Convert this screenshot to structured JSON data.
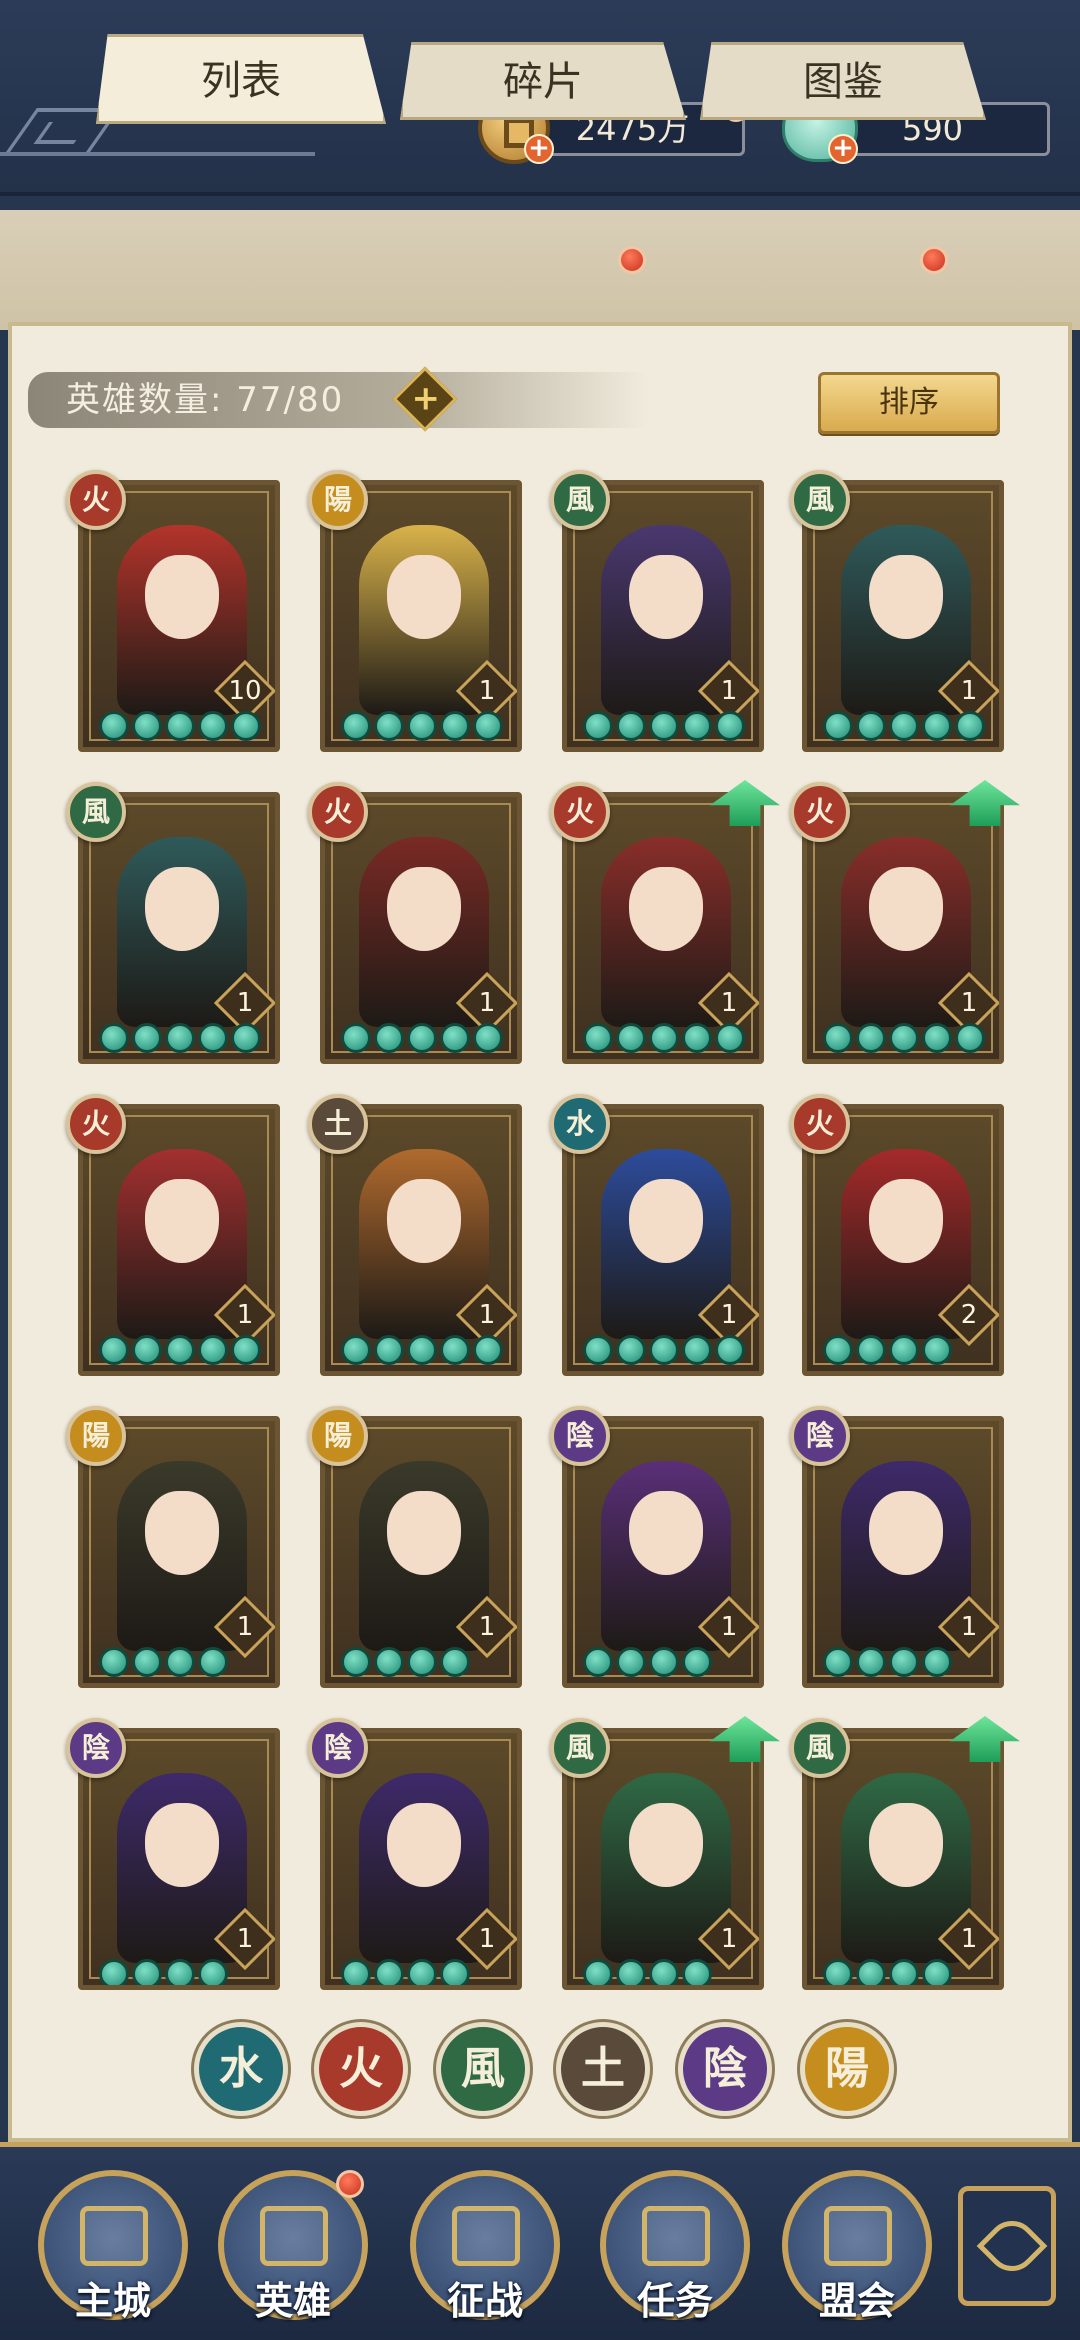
{
  "resources": {
    "coins": "2475万",
    "jade": "590"
  },
  "tabs": [
    {
      "label": "列表",
      "active": true,
      "has_dot": false
    },
    {
      "label": "碎片",
      "active": false,
      "has_dot": true
    },
    {
      "label": "图鉴",
      "active": false,
      "has_dot": true
    }
  ],
  "hero_count_label": "英雄数量: 77/80",
  "sort_label": "排序",
  "element_colors": {
    "fire": "#a83a2b",
    "yang": "#c58d1e",
    "wind": "#2f6a45",
    "yin": "#5c3a86",
    "water": "#1f6a73",
    "earth": "#5a4a3a"
  },
  "heroes": [
    {
      "element": "fire",
      "glyph": "火",
      "level": "10",
      "stars": 5,
      "upgradable": false,
      "tone": "#b3342b"
    },
    {
      "element": "yang",
      "glyph": "陽",
      "level": "1",
      "stars": 5,
      "upgradable": false,
      "tone": "#d9b24a"
    },
    {
      "element": "wind",
      "glyph": "風",
      "level": "1",
      "stars": 5,
      "upgradable": false,
      "tone": "#4a3870"
    },
    {
      "element": "wind",
      "glyph": "風",
      "level": "1",
      "stars": 5,
      "upgradable": false,
      "tone": "#2f5a5a"
    },
    {
      "element": "wind",
      "glyph": "風",
      "level": "1",
      "stars": 5,
      "upgradable": false,
      "tone": "#2f5a5a"
    },
    {
      "element": "fire",
      "glyph": "火",
      "level": "1",
      "stars": 5,
      "upgradable": false,
      "tone": "#7a2a24"
    },
    {
      "element": "fire",
      "glyph": "火",
      "level": "1",
      "stars": 5,
      "upgradable": true,
      "tone": "#8a2e2a"
    },
    {
      "element": "fire",
      "glyph": "火",
      "level": "1",
      "stars": 5,
      "upgradable": true,
      "tone": "#8a2e2a"
    },
    {
      "element": "fire",
      "glyph": "火",
      "level": "1",
      "stars": 5,
      "upgradable": false,
      "tone": "#a33030"
    },
    {
      "element": "earth",
      "glyph": "土",
      "level": "1",
      "stars": 5,
      "upgradable": false,
      "tone": "#b06a2e"
    },
    {
      "element": "water",
      "glyph": "水",
      "level": "1",
      "stars": 5,
      "upgradable": false,
      "tone": "#2d4c9c"
    },
    {
      "element": "fire",
      "glyph": "火",
      "level": "2",
      "stars": 4,
      "upgradable": false,
      "tone": "#a52a2a"
    },
    {
      "element": "yang",
      "glyph": "陽",
      "level": "1",
      "stars": 4,
      "upgradable": false,
      "tone": "#3a3a2a"
    },
    {
      "element": "yang",
      "glyph": "陽",
      "level": "1",
      "stars": 4,
      "upgradable": false,
      "tone": "#3a3a2a"
    },
    {
      "element": "yin",
      "glyph": "陰",
      "level": "1",
      "stars": 4,
      "upgradable": false,
      "tone": "#5a2f78"
    },
    {
      "element": "yin",
      "glyph": "陰",
      "level": "1",
      "stars": 4,
      "upgradable": false,
      "tone": "#3e2a6a"
    },
    {
      "element": "yin",
      "glyph": "陰",
      "level": "1",
      "stars": 4,
      "upgradable": false,
      "tone": "#3e2a6a"
    },
    {
      "element": "yin",
      "glyph": "陰",
      "level": "1",
      "stars": 4,
      "upgradable": false,
      "tone": "#3e2a6a"
    },
    {
      "element": "wind",
      "glyph": "風",
      "level": "1",
      "stars": 4,
      "upgradable": true,
      "tone": "#2f6a45"
    },
    {
      "element": "wind",
      "glyph": "風",
      "level": "1",
      "stars": 4,
      "upgradable": true,
      "tone": "#2f6a45"
    }
  ],
  "element_filters": [
    {
      "element": "water",
      "glyph": "水"
    },
    {
      "element": "fire",
      "glyph": "火"
    },
    {
      "element": "wind",
      "glyph": "風"
    },
    {
      "element": "earth",
      "glyph": "土"
    },
    {
      "element": "yin",
      "glyph": "陰"
    },
    {
      "element": "yang",
      "glyph": "陽"
    }
  ],
  "nav": [
    {
      "label": "主城",
      "icon": "city-gate-icon",
      "has_dot": false
    },
    {
      "label": "英雄",
      "icon": "hero-portrait-icon",
      "has_dot": true
    },
    {
      "label": "征战",
      "icon": "battle-drum-icon",
      "has_dot": false
    },
    {
      "label": "任务",
      "icon": "scroll-icon",
      "has_dot": false
    },
    {
      "label": "盟会",
      "icon": "pavilion-icon",
      "has_dot": false
    }
  ]
}
